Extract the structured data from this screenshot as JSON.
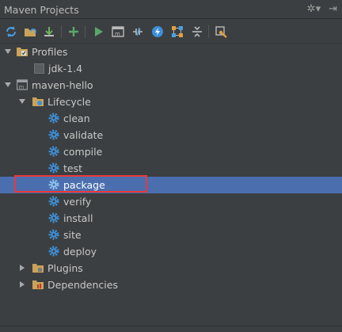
{
  "panel": {
    "title": "Maven Projects",
    "settings_glyph": "✲▾",
    "hide_glyph": "⇥"
  },
  "toolbar": {
    "buttons": [
      {
        "name": "reimport-icon"
      },
      {
        "name": "generate-sources-icon"
      },
      {
        "name": "download-sources-icon"
      },
      {
        "name": "add-maven-project-icon"
      },
      {
        "name": "run-icon"
      },
      {
        "name": "execute-goal-icon"
      },
      {
        "name": "toggle-offline-icon"
      },
      {
        "name": "skip-tests-icon"
      },
      {
        "name": "show-dependencies-icon"
      },
      {
        "name": "collapse-all-icon"
      },
      {
        "name": "maven-settings-icon"
      }
    ]
  },
  "tree": {
    "profiles": "Profiles",
    "profile_items": [
      "jdk-1.4"
    ],
    "project": "maven-hello",
    "lifecycle": "Lifecycle",
    "goals": [
      "clean",
      "validate",
      "compile",
      "test",
      "package",
      "verify",
      "install",
      "site",
      "deploy"
    ],
    "selected_goal": "package",
    "plugins": "Plugins",
    "dependencies": "Dependencies"
  },
  "colors": {
    "background": "#3c3f41",
    "selection": "#4b6eaf",
    "highlight_border": "#e8393b",
    "gear": "#3d8fd8"
  }
}
